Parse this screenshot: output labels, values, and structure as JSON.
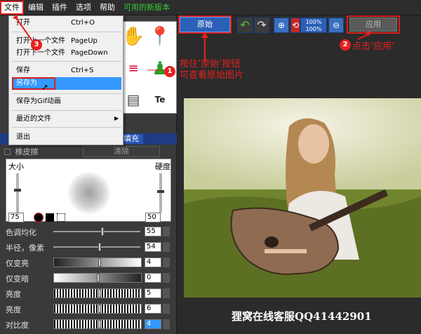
{
  "menubar": {
    "items": [
      {
        "label": "文件",
        "active": true
      },
      {
        "label": "编辑"
      },
      {
        "label": "插件"
      },
      {
        "label": "选项"
      },
      {
        "label": "帮助"
      },
      {
        "label": "可用的新版本",
        "highlight": "#38c838"
      }
    ]
  },
  "file_menu": {
    "items": [
      {
        "label": "打开",
        "shortcut": "Ctrl+O"
      },
      {
        "label": "打开上一个文件",
        "shortcut": "PageUp"
      },
      {
        "label": "打开下一个文件",
        "shortcut": "PageDown"
      },
      {
        "label": "保存",
        "shortcut": "Ctrl+S"
      },
      {
        "label": "另存为",
        "shortcut": "",
        "selected": true
      },
      {
        "label": "保存为Gif动画",
        "shortcut": ""
      },
      {
        "label": "最近的文件",
        "shortcut": "",
        "submenu": true
      },
      {
        "label": "退出",
        "shortcut": ""
      }
    ]
  },
  "toolbar": {
    "original_label": "原始",
    "apply_label": "应用",
    "zoom_line1": "100%",
    "zoom_line2": "100%"
  },
  "brush_panel": {
    "fill_label": "填充",
    "eraser_label": "橡皮擦",
    "clear_label": "清除",
    "size_label": "大小",
    "hardness_label": "硬度",
    "size_value": "75",
    "hardness_value": "50"
  },
  "params": [
    {
      "label": "色调均化",
      "value": "55"
    },
    {
      "label": "半径，像素",
      "value": "54"
    },
    {
      "label": "仅变亮",
      "value": "4"
    },
    {
      "label": "仅变暗",
      "value": "0"
    },
    {
      "label": "亮度",
      "value": "5"
    },
    {
      "label": "亮度",
      "value": "6"
    },
    {
      "label": "对比度",
      "value": "4"
    }
  ],
  "annotations": {
    "step1_num": "1",
    "step1_text1": "按住‘原始’按钮",
    "step1_text2": "可查看原始图片",
    "step2_num": "2",
    "step2_text": "点击‘应用’",
    "step3_num": "3"
  },
  "watermark": "狸窝在线客服QQ41442901",
  "colors": {
    "accent_red": "#e62020",
    "selection_blue": "#3399ff",
    "button_blue": "#2c5fb8"
  }
}
